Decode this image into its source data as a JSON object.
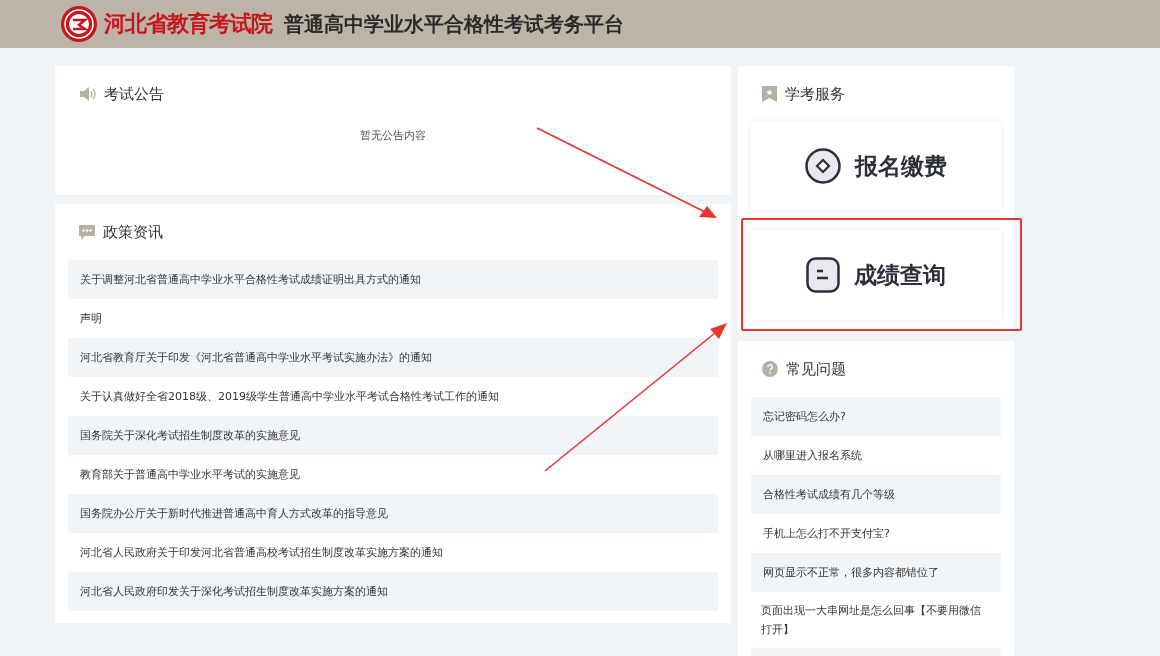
{
  "header": {
    "org_name": "河北省教育考试院",
    "platform_title": "普通高中学业水平合格性考试考务平台"
  },
  "announcements": {
    "title": "考试公告",
    "empty_text": "暂无公告内容"
  },
  "policy_news": {
    "title": "政策资讯",
    "items": [
      "关于调整河北省普通高中学业水平合格性考试成绩证明出具方式的通知",
      "声明",
      "河北省教育厅关于印发《河北省普通高中学业水平考试实施办法》的通知",
      "关于认真做好全省2018级、2019级学生普通高中学业水平考试合格性考试工作的通知",
      "国务院关于深化考试招生制度改革的实施意见",
      "教育部关于普通高中学业水平考试的实施意见",
      "国务院办公厅关于新时代推进普通高中育人方式改革的指导意见",
      "河北省人民政府关于印发河北省普通高校考试招生制度改革实施方案的通知",
      "河北省人民政府印发关于深化考试招生制度改革实施方案的通知"
    ]
  },
  "services": {
    "title": "学考服务",
    "items": [
      {
        "label": "报名缴费",
        "kind": "register",
        "highlighted": false
      },
      {
        "label": "成绩查询",
        "kind": "scores",
        "highlighted": true
      }
    ]
  },
  "faq": {
    "title": "常见问题",
    "items": [
      "忘记密码怎么办?",
      "从哪里进入报名系统",
      "合格性考试成绩有几个等级",
      "手机上怎么打不开支付宝?",
      "网页显示不正常，很多内容都错位了",
      "页面出现一大串网址是怎么回事【不要用微信打开】"
    ]
  }
}
